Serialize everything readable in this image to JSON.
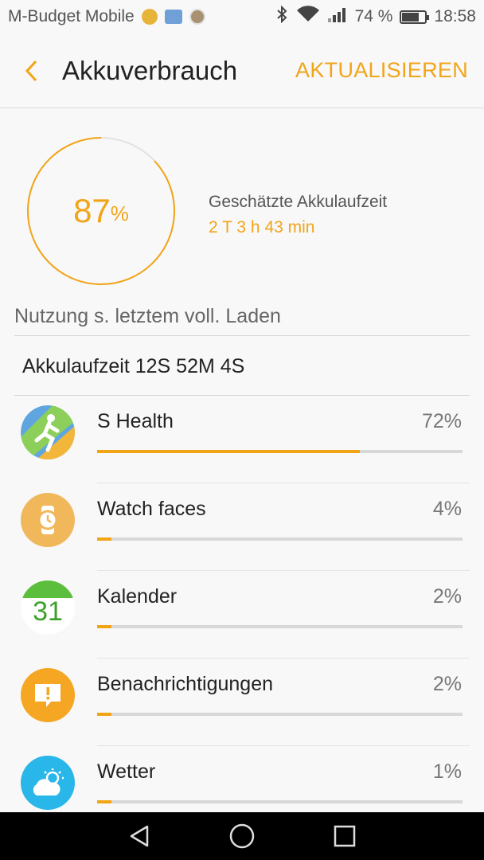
{
  "status_bar": {
    "carrier": "M-Budget Mobile",
    "battery_percent": "74 %",
    "battery_level": 0.74,
    "time": "18:58",
    "icons": [
      "safari-compass-icon",
      "photo-notification-icon",
      "contact-avatar-icon",
      "bluetooth-icon",
      "wifi-icon",
      "signal-icon",
      "battery-icon"
    ]
  },
  "header": {
    "title": "Akkuverbrauch",
    "refresh_label": "AKTUALISIEREN",
    "accent_color": "#f2a417"
  },
  "gauge": {
    "value": "87",
    "unit": "%",
    "level": 0.87
  },
  "estimate": {
    "label": "Geschätzte Akkulaufzeit",
    "value": "2 T 3 h 43 min"
  },
  "section_title": "Nutzung s. letztem voll. Laden",
  "runtime": "Akkulaufzeit 12S 52M 4S",
  "apps": [
    {
      "name": "S Health",
      "percent": "72%",
      "usage": 0.72,
      "icon": "s-health-icon"
    },
    {
      "name": "Watch faces",
      "percent": "4%",
      "usage": 0.04,
      "icon": "watch-icon"
    },
    {
      "name": "Kalender",
      "percent": "2%",
      "usage": 0.02,
      "icon": "calendar-icon",
      "icon_text": "31"
    },
    {
      "name": "Benachrichtigungen",
      "percent": "2%",
      "usage": 0.02,
      "icon": "notification-icon"
    },
    {
      "name": "Wetter",
      "percent": "1%",
      "usage": 0.01,
      "icon": "weather-icon"
    }
  ],
  "nav": [
    "back-icon",
    "home-icon",
    "recents-icon"
  ]
}
